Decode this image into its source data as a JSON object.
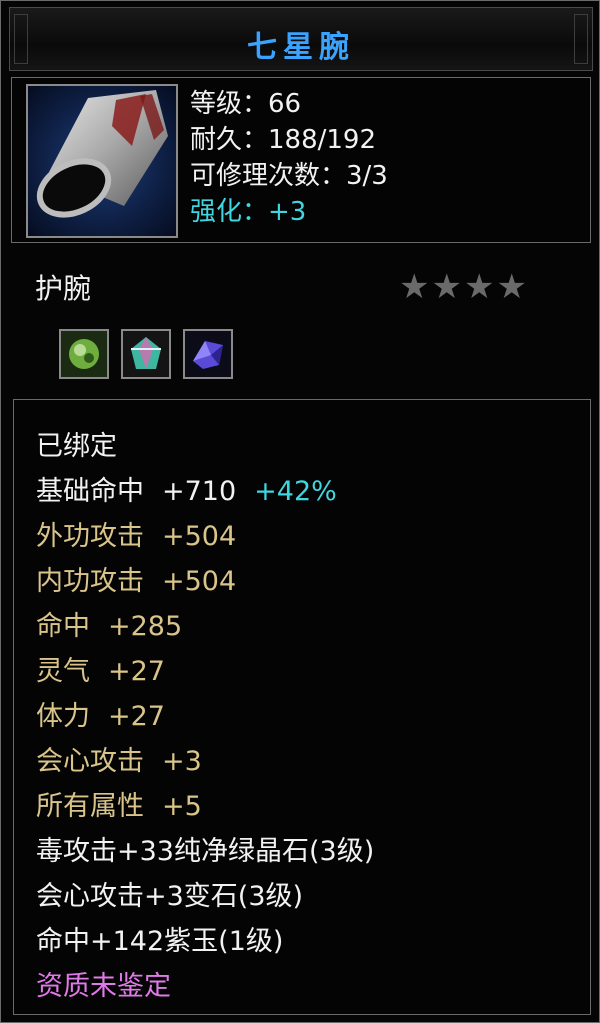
{
  "item": {
    "name": "七星腕",
    "slot": "护腕",
    "stars_filled": 0,
    "stars_total": 4,
    "stars": "★★★★"
  },
  "stats": {
    "level": "等级：66",
    "durability": "耐久：188/192",
    "repairs": "可修理次数：3/3",
    "enhance": "强化：+3"
  },
  "gems": [
    {
      "name": "纯净绿晶石",
      "color": "#6fae3e"
    },
    {
      "name": "变石",
      "color": "#3fb7a0"
    },
    {
      "name": "紫玉",
      "color": "#5a4ad8"
    }
  ],
  "attributes": {
    "bound": "已绑定",
    "base_hit": "基础命中",
    "base_hit_value": "+710",
    "base_hit_bonus": "+42%",
    "external_attack": "外功攻击",
    "external_attack_value": "+504",
    "internal_attack": "内功攻击",
    "internal_attack_value": "+504",
    "hit": "命中",
    "hit_value": "+285",
    "spirit": "灵气",
    "spirit_value": "+27",
    "stamina": "体力",
    "stamina_value": "+27",
    "crit_attack": "会心攻击",
    "crit_attack_value": "+3",
    "all_attributes": "所有属性",
    "all_attributes_value": "+5",
    "gem_line_1": "毒攻击+33纯净绿晶石(3级)",
    "gem_line_2": "会心攻击+3变石(3级)",
    "gem_line_3": "命中+142紫玉(1级)",
    "quality": "资质未鉴定"
  },
  "colors": {
    "title": "#3aa2ff",
    "normal": "#f2f2f2",
    "bonus": "#3fd6e0",
    "base_attr": "#d9c48a",
    "quality": "#e07ae8",
    "star_empty": "#6a6a6a"
  }
}
